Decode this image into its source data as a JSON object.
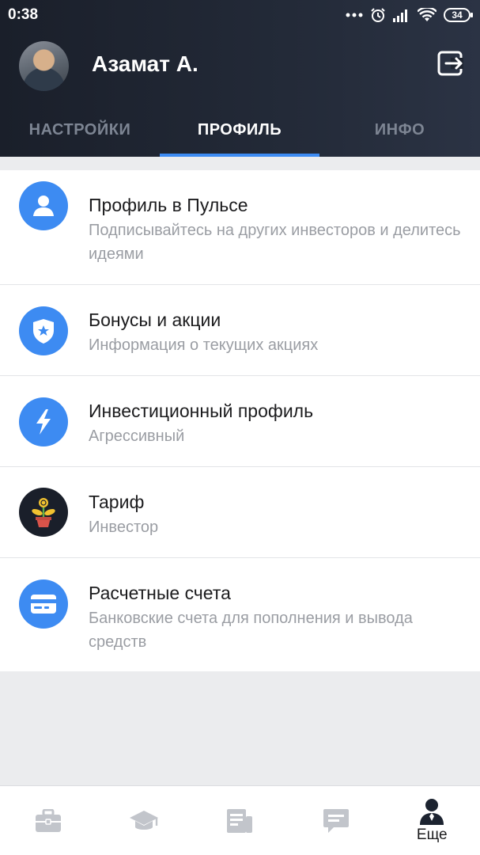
{
  "status_bar": {
    "time": "0:38",
    "battery": "34",
    "icons": [
      "dots-icon",
      "alarm-icon",
      "signal-icon",
      "wifi-icon",
      "battery-icon"
    ]
  },
  "header": {
    "user_name": "Азамат А.",
    "logout_icon": "logout-icon"
  },
  "tabs": [
    {
      "label": "НАСТРОЙКИ",
      "active": false
    },
    {
      "label": "ПРОФИЛЬ",
      "active": true
    },
    {
      "label": "ИНФО",
      "active": false
    }
  ],
  "menu": [
    {
      "title": "Профиль в Пульсе",
      "subtitle": "Подписывайтесь на других инвесторов и делитесь идеями",
      "icon": "person-icon"
    },
    {
      "title": "Бонусы и акции",
      "subtitle": "Информация о текущих акциях",
      "icon": "shield-star-icon"
    },
    {
      "title": "Инвестиционный профиль",
      "subtitle": "Агрессивный",
      "icon": "lightning-icon"
    },
    {
      "title": "Тариф",
      "subtitle": "Инвестор",
      "icon": "money-plant-icon"
    },
    {
      "title": "Расчетные счета",
      "subtitle": "Банковские счета для пополнения и вывода средств",
      "icon": "card-icon"
    }
  ],
  "bottom_nav": [
    {
      "icon": "briefcase-icon",
      "label": ""
    },
    {
      "icon": "graduation-cap-icon",
      "label": ""
    },
    {
      "icon": "news-icon",
      "label": ""
    },
    {
      "icon": "chat-icon",
      "label": ""
    },
    {
      "icon": "profile-icon",
      "label": "Еще",
      "active": true
    }
  ],
  "colors": {
    "accent": "#3d8bf2",
    "header_bg": "#1f2531",
    "inactive_icon": "#c2c5cb"
  }
}
